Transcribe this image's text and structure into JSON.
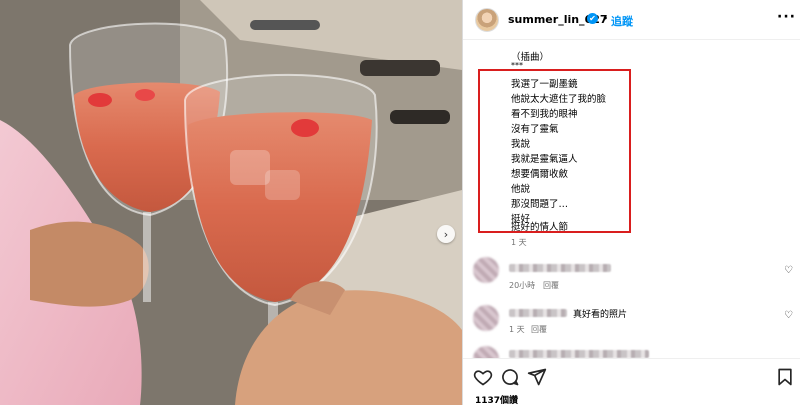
{
  "post": {
    "username": "summer_lin_627",
    "verified_mark": "✔",
    "separator": "•",
    "follow_label": "追蹤",
    "more_label": "···"
  },
  "caption": {
    "lines": [
      "（插曲）",
      "***",
      "我選了一副墨鏡",
      "他說太大遮住了我的臉",
      "看不到我的眼神",
      "沒有了靈氣",
      "我說",
      "我就是靈氣逼人",
      "想要偶爾收斂",
      "他說",
      "那沒問題了…",
      "挺好",
      "",
      "挺好的情人節"
    ],
    "age": "1 天"
  },
  "comments": [
    {
      "text": "",
      "age": "20小時",
      "reply_label": "回覆"
    },
    {
      "text": "真好看的照片",
      "age": "1 天",
      "reply_label": "回覆"
    },
    {
      "text": "",
      "age": "",
      "reply_label": ""
    }
  ],
  "footer": {
    "likes": "1137個讚"
  },
  "icons": {
    "heart": "heart-icon",
    "comment": "comment-icon",
    "share": "share-icon",
    "bookmark": "bookmark-icon",
    "carousel_next": "chevron-right-icon"
  },
  "colors": {
    "link_blue": "#0095f6",
    "highlight_red": "#d91e1e"
  }
}
